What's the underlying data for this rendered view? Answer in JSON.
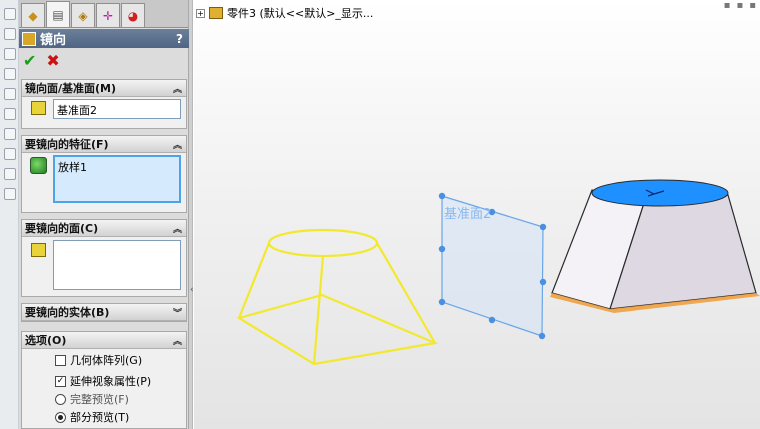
{
  "panel": {
    "tab_icons": [
      "feature-manager-icon",
      "property-manager-icon",
      "configuration-manager-icon",
      "dimxpert-icon",
      "display-manager-icon"
    ],
    "header": {
      "title": "镜向",
      "help": "?"
    },
    "groups": {
      "mirror_plane": {
        "title": "镜向面/基准面(M)",
        "value": "基准面2"
      },
      "features": {
        "title": "要镜向的特征(F)",
        "items": [
          "放样1"
        ]
      },
      "faces": {
        "title": "要镜向的面(C)"
      },
      "bodies": {
        "title": "要镜向的实体(B)"
      },
      "options": {
        "title": "选项(O)",
        "geometry_pattern": {
          "label": "几何体阵列(G)",
          "checked": false
        },
        "propagate_visual": {
          "label": "延伸视象属性(P)",
          "checked": true
        },
        "full_preview": {
          "label": "完整预览(F)",
          "selected": false
        },
        "partial_preview": {
          "label": "部分预览(T)",
          "selected": true
        }
      }
    }
  },
  "viewport": {
    "tree_item": "零件3 (默认<<默认>_显示...",
    "plane_label": "基准面2",
    "colors": {
      "preview_wireframe": "#f2e92e",
      "plane": "#6aa6e8",
      "selected_face": "#1e90ff",
      "solid_body": "#ece8ee",
      "edge_highlight": "#f0a040"
    }
  }
}
